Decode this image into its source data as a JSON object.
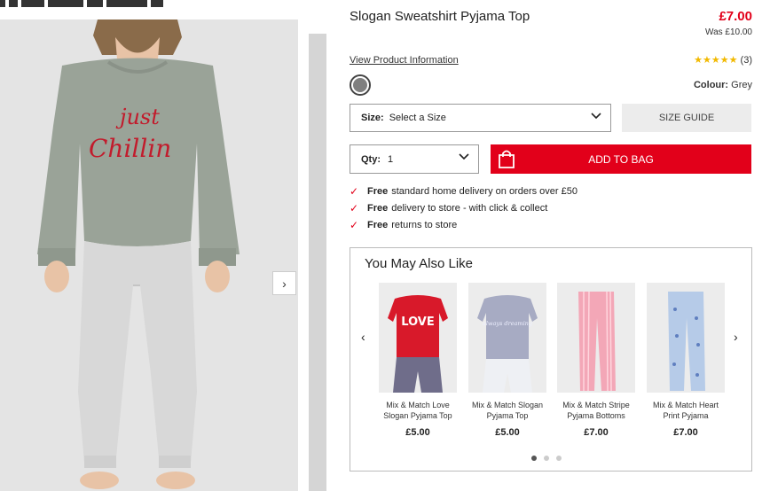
{
  "product": {
    "title": "Slogan Sweatshirt Pyjama Top",
    "price": "£7.00",
    "was_price": "Was £10.00",
    "view_info": "View Product Information",
    "stars": "★★★★★",
    "rating_count": "(3)",
    "colour_label": "Colour:",
    "colour_value": "Grey",
    "image_slogan_line1": "just",
    "image_slogan_line2": "Chillin"
  },
  "size": {
    "label": "Size:",
    "value": "Select a Size",
    "guide": "SIZE GUIDE"
  },
  "qty": {
    "label": "Qty:",
    "value": "1"
  },
  "add_to_bag": "ADD TO BAG",
  "delivery": [
    {
      "bold": "Free",
      "text": "standard home delivery on orders over £50"
    },
    {
      "bold": "Free",
      "text": "delivery to store - with click & collect"
    },
    {
      "bold": "Free",
      "text": "returns to store"
    }
  ],
  "recommendations": {
    "title": "You May Also Like",
    "items": [
      {
        "name": "Mix & Match Love Slogan Pyjama Top",
        "price": "£5.00",
        "slogan": "LOVE"
      },
      {
        "name": "Mix & Match Slogan Pyjama Top",
        "price": "£5.00",
        "slogan": "always dreaming"
      },
      {
        "name": "Mix & Match Stripe Pyjama Bottoms",
        "price": "£7.00"
      },
      {
        "name": "Mix & Match Heart Print Pyjama",
        "price": "£7.00"
      }
    ]
  },
  "icons": {
    "gallery_next": "›",
    "rec_prev": "‹",
    "rec_next": "›",
    "chevron": "⌄",
    "tick": "✓"
  },
  "colors": {
    "accent": "#e2001a",
    "star": "#f2b900",
    "swatch": "#7f7f7f"
  }
}
